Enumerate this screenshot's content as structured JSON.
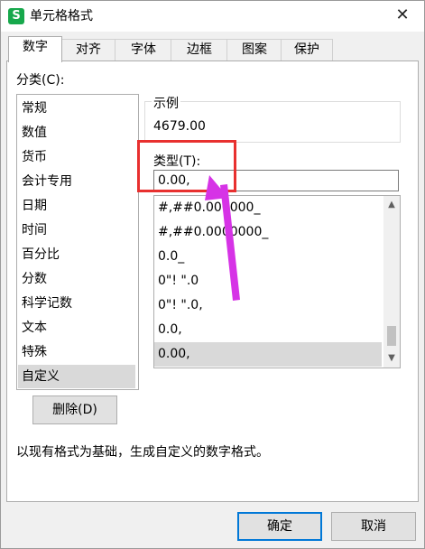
{
  "window": {
    "app_icon": "S",
    "title": "单元格格式",
    "close": "✕"
  },
  "tabs": [
    {
      "label": "数字",
      "active": true
    },
    {
      "label": "对齐",
      "active": false
    },
    {
      "label": "字体",
      "active": false
    },
    {
      "label": "边框",
      "active": false
    },
    {
      "label": "图案",
      "active": false
    },
    {
      "label": "保护",
      "active": false
    }
  ],
  "category": {
    "label": "分类(C):",
    "items": [
      "常规",
      "数值",
      "货币",
      "会计专用",
      "日期",
      "时间",
      "百分比",
      "分数",
      "科学记数",
      "文本",
      "特殊",
      "自定义"
    ],
    "selected": "自定义"
  },
  "sample": {
    "label": "示例",
    "value": "4679.00"
  },
  "type": {
    "label": "类型(T):",
    "value": "0.00,"
  },
  "format_list": {
    "items": [
      "#,##0.000000_",
      "#,##0.0000000_",
      "0.0_",
      "0\"!  \".0",
      "0\"!  \".0,",
      "0.0,",
      "0.00,"
    ],
    "selected": "0.00,"
  },
  "delete_button": "删除(D)",
  "description": "以现有格式为基础，生成自定义的数字格式。",
  "buttons": {
    "ok": "确定",
    "cancel": "取消"
  },
  "colors": {
    "annotation_box": "#e8302f",
    "annotation_arrow": "#d633e6",
    "focus_border": "#0078d7",
    "app_icon": "#17a84c"
  }
}
